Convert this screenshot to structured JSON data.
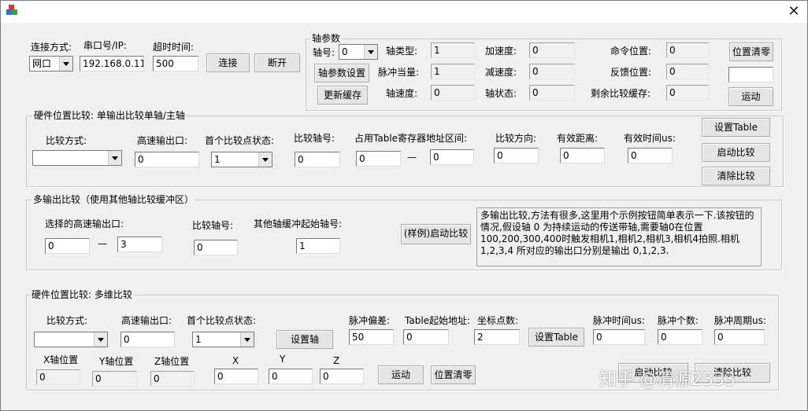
{
  "window": {
    "close_glyph": "✕"
  },
  "connection": {
    "type_label": "连接方式:",
    "ip_label": "串口号/IP:",
    "timeout_label": "超时时间:",
    "type_value": "网口",
    "ip_value": "192.168.0.11",
    "timeout_value": "500",
    "connect_label": "连接",
    "disconnect_label": "断开"
  },
  "axis_params": {
    "title": "轴参数",
    "axis_no_label": "轴号:",
    "axis_no_value": "0",
    "axis_type_label": "轴类型:",
    "axis_type_value": "1",
    "accel_label": "加速度:",
    "accel_value": "0",
    "cmd_pos_label": "命令位置:",
    "cmd_pos_value": "0",
    "pos_clear_label": "位置清零",
    "set_button_label": "轴参数设置",
    "pulse_eq_label": "脉冲当量:",
    "pulse_eq_value": "1",
    "decel_label": "减速度:",
    "decel_value": "0",
    "fb_pos_label": "反馈位置:",
    "fb_pos_value": "0",
    "move_value": "",
    "move_label": "运动",
    "update_buffer_label": "更新缓存",
    "speed_label": "轴速度:",
    "speed_value": "0",
    "status_label": "轴状态:",
    "status_value": "0",
    "remain_label": "剩余比较缓存:",
    "remain_value": "0"
  },
  "hw_single": {
    "title": "硬件位置比较: 单输出比较单轴/主轴",
    "compare_mode_label": "比较方式:",
    "compare_mode_value": "",
    "hs_out_label": "高速输出口:",
    "hs_out_value": "0",
    "first_state_label": "首个比较点状态:",
    "first_state_value": "1",
    "axis_label": "比较轴号:",
    "axis_value": "0",
    "table_range_label": "占用Table寄存器地址区间:",
    "table_start_value": "0",
    "table_end_value": "0",
    "dash": "—",
    "direction_label": "比较方向:",
    "direction_value": "0",
    "valid_dist_label": "有效距离:",
    "valid_dist_value": "0",
    "valid_time_label": "有效时间us:",
    "valid_time_value": "0",
    "set_table_label": "设置Table",
    "start_label": "启动比较",
    "clear_label": "清除比较"
  },
  "multi_out": {
    "title": "多输出比较（使用其他轴比较缓冲区）",
    "selected_hs_label": "选择的高速输出口:",
    "hs_from_value": "0",
    "hs_to_value": "3",
    "dash": "—",
    "axis_label": "比较轴号:",
    "axis_value": "0",
    "buffer_axis_label": "其他轴缓冲起始轴号:",
    "buffer_axis_value": "1",
    "sample_start_label": "(样例)启动比较",
    "info_lines": [
      "多输出比较,方法有很多,这里用个示例按钮简单表示一下.该按钮的",
      "情况,假设轴 0 为持续运动的传送带轴,需要轴0在位置",
      "100,200,300,400时触发相机1,相机2,相机3,相机4拍照.相机",
      "1,2,3,4 所对应的输出口分别是输出 0,1,2,3."
    ]
  },
  "hw_multi": {
    "title": "硬件位置比较: 多维比较",
    "compare_mode_label": "比较方式:",
    "compare_mode_value": "",
    "hs_out_label": "高速输出口:",
    "hs_out_value": "0",
    "first_state_label": "首个比较点状态:",
    "first_state_value": "1",
    "set_axis_label": "设置轴",
    "pulse_offset_label": "脉冲偏差:",
    "pulse_offset_value": "50",
    "table_start_label": "Table起始地址:",
    "table_start_value": "0",
    "coord_count_label": "坐标点数:",
    "coord_count_value": "2",
    "set_table_label": "设置Table",
    "pulse_time_label": "脉冲时间us:",
    "pulse_time_value": "0",
    "pulse_count_label": "脉冲个数:",
    "pulse_count_value": "0",
    "pulse_period_label": "脉冲周期us:",
    "pulse_period_value": "0",
    "x_pos_label": "X轴位置",
    "x_pos_value": "0",
    "y_pos_label": "Y轴位置",
    "y_pos_value": "0",
    "z_pos_label": "Z轴位置",
    "z_pos_value": "0",
    "x_label": "X",
    "x_value": "0",
    "y_label": "Y",
    "y_value": "0",
    "z_label": "Z",
    "z_value": "0",
    "move_label": "运动",
    "pos_clear_label": "位置清零",
    "start_label": "启动比较",
    "clear_label": "清除比较"
  },
  "watermark": {
    "text": "知乎 @清源2333"
  }
}
